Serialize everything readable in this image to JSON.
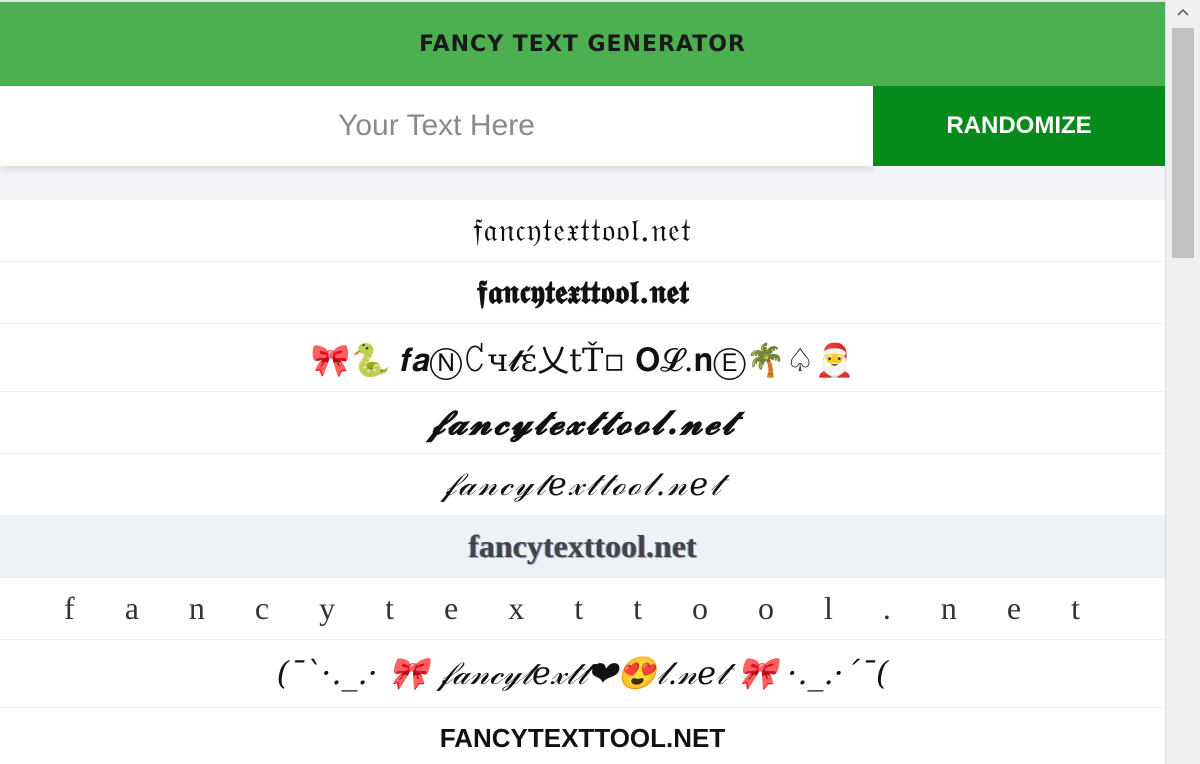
{
  "header": {
    "title": "FANCY TEXT GENERATOR"
  },
  "input": {
    "placeholder": "Your Text Here",
    "value": ""
  },
  "randomize_label": "RANDOMIZE",
  "results": [
    "𝔣𝔞𝔫𝔠𝔶𝔱𝔢𝔵𝔱𝔱𝔬𝔬𝔩.𝔫𝔢𝔱",
    "𝖋𝖆𝖓𝖈𝖞𝖙𝖊𝖝𝖙𝖙𝖔𝖔𝖑.𝖓𝖊𝖙",
    "🎀🐍 𝒇𝒂Ⓝ꒝ч𝓽έ乂tŤ▫ 𝐎𝓛.𝐧Ⓔ🌴♤🎅",
    "𝓯𝓪𝓷𝓬𝔂𝓽𝓮𝔁𝓽𝓽𝓸𝓸𝓵.𝓷𝓮𝓽",
    "𝒻𝒶𝓃𝒸𝓎𝓉𝑒𝓍𝓉𝓉ℴℴ𝓁.𝓃𝑒𝓉",
    "fancytexttool.net",
    "f a n c y t e x t t o o l . n e t",
    "(¯`·._.· 🎀 𝒻𝒶𝓃𝒸𝓎𝓉𝑒𝓍𝓉𝓉❤😍𝓁.𝓃𝑒𝓉 🎀 ·._.·´¯(",
    "FANCYTEXTTOOL.NET"
  ]
}
